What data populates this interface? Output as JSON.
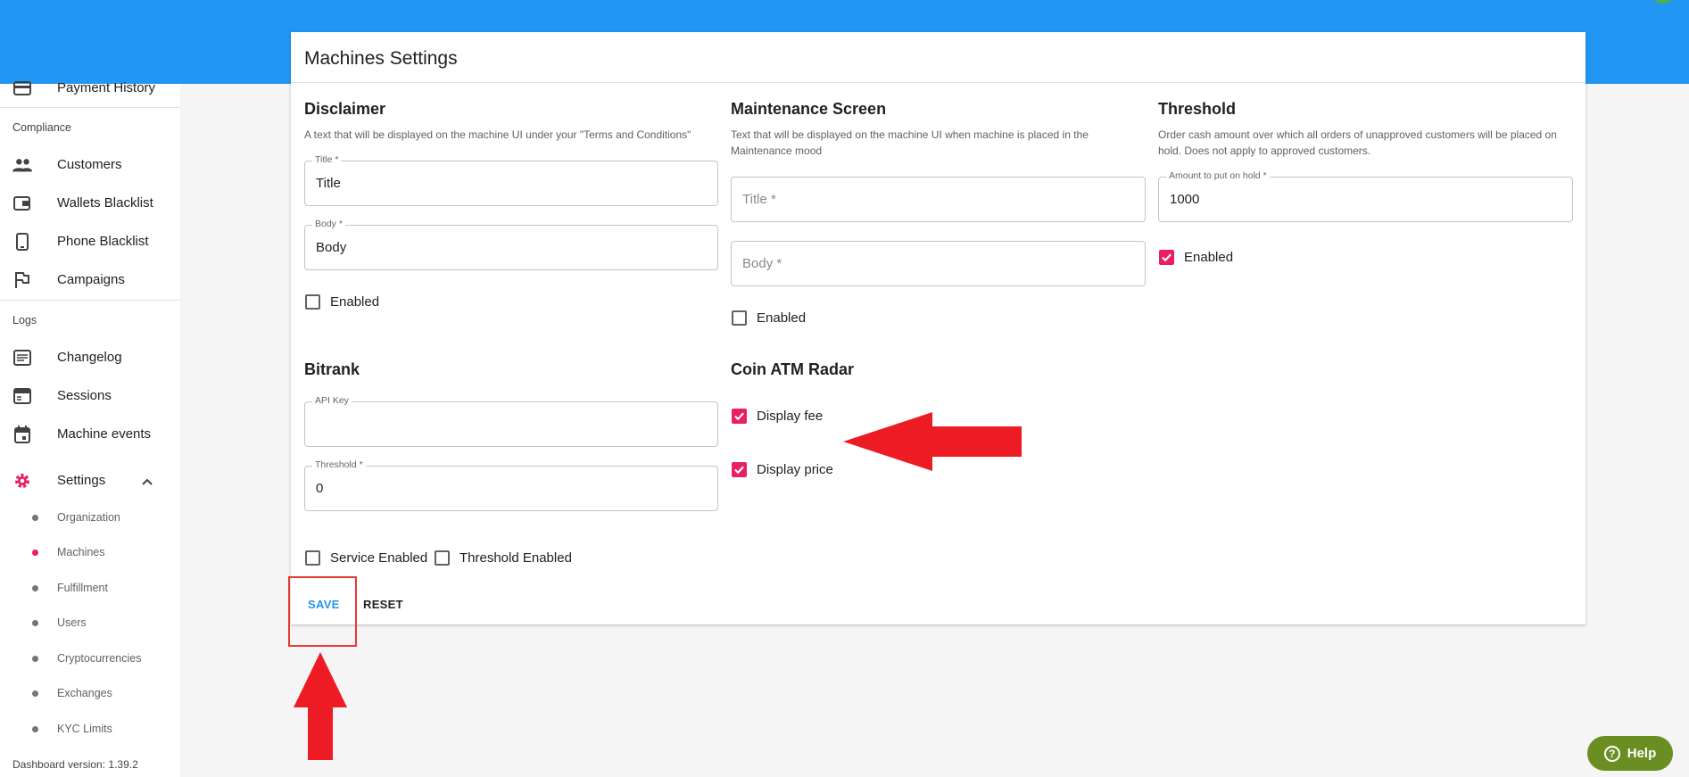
{
  "sidebar": {
    "payment_history": "Payment History",
    "compliance_label": "Compliance",
    "compliance_items": [
      "Customers",
      "Wallets Blacklist",
      "Phone Blacklist",
      "Campaigns"
    ],
    "logs_label": "Logs",
    "logs_items": [
      "Changelog",
      "Sessions",
      "Machine events"
    ],
    "settings_label": "Settings",
    "settings_sub": [
      "Organization",
      "Machines",
      "Fulfillment",
      "Users",
      "Cryptocurrencies",
      "Exchanges",
      "KYC Limits"
    ],
    "active_sub": "Machines",
    "version": "Dashboard version: 1.39.2"
  },
  "panel": {
    "title": "Machines Settings",
    "disclaimer": {
      "heading": "Disclaimer",
      "desc": "A text that will be displayed on the machine UI under your \"Terms and Conditions\"",
      "title_label": "Title *",
      "title_value": "Title",
      "body_label": "Body *",
      "body_value": "Body",
      "enabled_label": "Enabled",
      "enabled": false
    },
    "maintenance": {
      "heading": "Maintenance Screen",
      "desc": "Text that will be displayed on the machine UI when machine is placed in the Maintenance mood",
      "title_placeholder": "Title *",
      "body_placeholder": "Body *",
      "enabled_label": "Enabled",
      "enabled": false
    },
    "threshold": {
      "heading": "Threshold",
      "desc": "Order cash amount over which all orders of unapproved customers will be placed on hold. Does not apply to approved customers.",
      "amount_label": "Amount to put on hold *",
      "amount_value": "1000",
      "enabled_label": "Enabled",
      "enabled": true
    },
    "bitrank": {
      "heading": "Bitrank",
      "api_key_label": "API Key",
      "api_key_value": "",
      "threshold_label": "Threshold *",
      "threshold_value": "0",
      "service_enabled_label": "Service Enabled",
      "threshold_enabled_label": "Threshold Enabled"
    },
    "coin_atm_radar": {
      "heading": "Coin ATM Radar",
      "display_fee_label": "Display fee",
      "display_price_label": "Display price"
    },
    "save_label": "SAVE",
    "reset_label": "RESET"
  },
  "help_label": "Help",
  "colors": {
    "topbar": "#2196f3",
    "accent": "#e91e63",
    "save": "#2196f3",
    "annotation": "#e53935",
    "help": "#6b8e23"
  }
}
